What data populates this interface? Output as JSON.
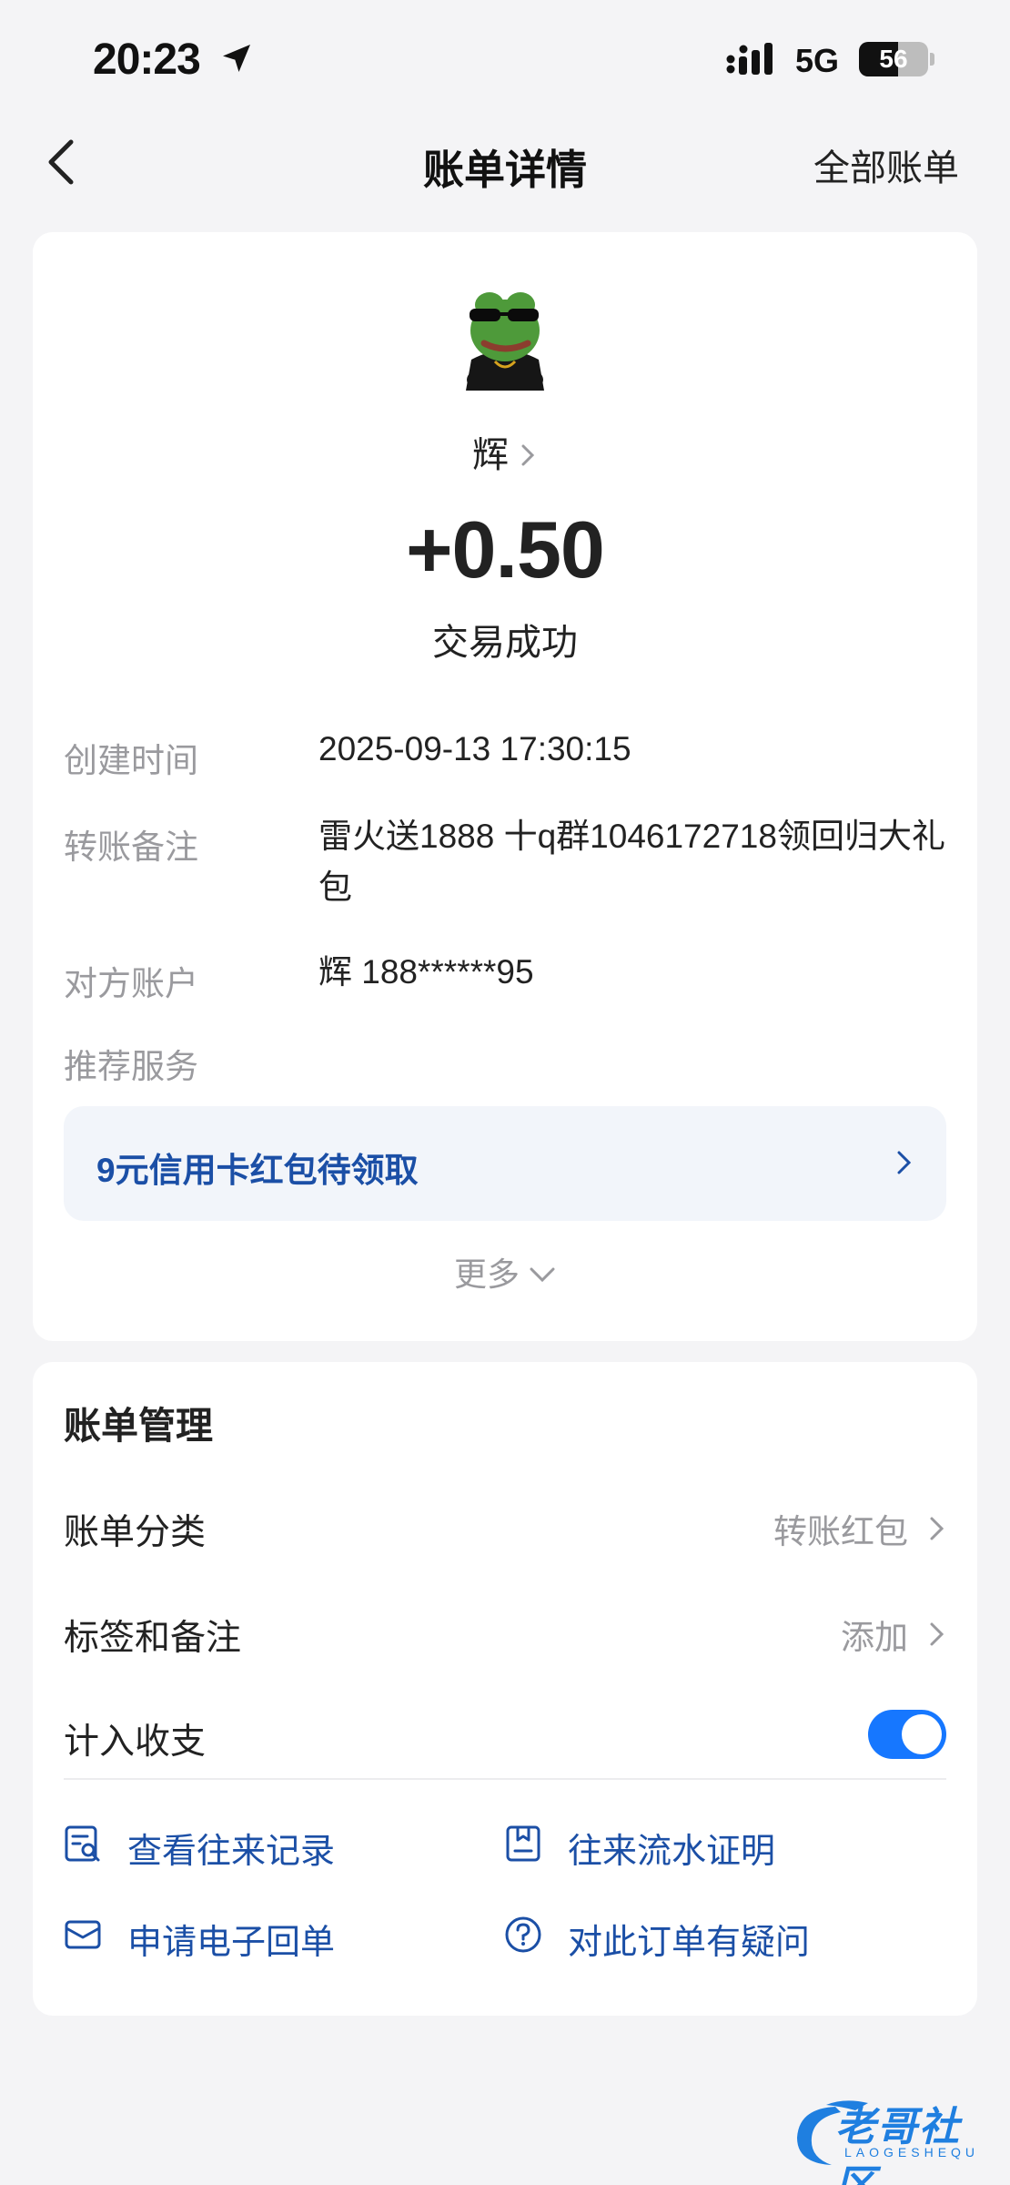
{
  "status_bar": {
    "time": "20:23",
    "network": "5G",
    "battery": "56",
    "battery_level": 0.56,
    "icons": [
      "location-arrow-icon",
      "signal-icon",
      "battery-icon"
    ]
  },
  "nav": {
    "title": "账单详情",
    "right_label": "全部账单",
    "back_icon": "chevron-left-icon"
  },
  "summary": {
    "name": "辉",
    "amount": "+0.50",
    "status": "交易成功"
  },
  "details": [
    {
      "label": "创建时间",
      "value": "2025-09-13 17:30:15"
    },
    {
      "label": "转账备注",
      "value": "雷火送1888 十q群1046172718领回归大礼包"
    },
    {
      "label": "对方账户",
      "value": "辉 188******95"
    },
    {
      "label": "推荐服务",
      "value": ""
    }
  ],
  "promo": {
    "text": "9元信用卡红包待领取"
  },
  "more": {
    "label": "更多"
  },
  "manage": {
    "title": "账单管理",
    "rows": [
      {
        "label": "账单分类",
        "value": "转账红包"
      },
      {
        "label": "标签和备注",
        "value": "添加"
      },
      {
        "label": "计入收支",
        "toggle_on": true
      }
    ],
    "actions": [
      {
        "label": "查看往来记录",
        "icon": "records-search-icon"
      },
      {
        "label": "往来流水证明",
        "icon": "certificate-icon"
      },
      {
        "label": "申请电子回单",
        "icon": "mail-icon"
      },
      {
        "label": "对此订单有疑问",
        "icon": "question-circle-icon"
      }
    ]
  },
  "colors": {
    "accent": "#1677ff",
    "link": "#1b4fa6",
    "background": "#f4f4f6",
    "muted_text": "#9a9a9e"
  },
  "watermark": {
    "text": "老哥社区",
    "sub": "LAOGESHEQU"
  }
}
